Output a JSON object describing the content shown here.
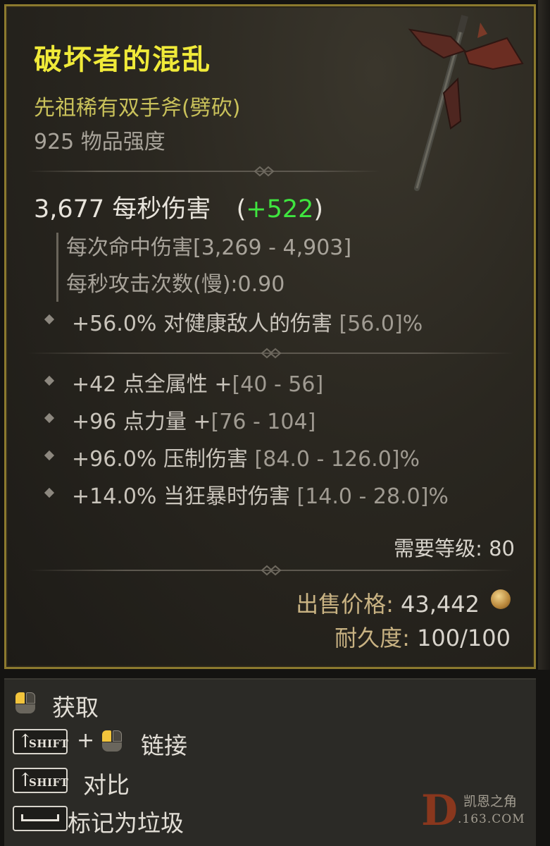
{
  "item": {
    "name": "破坏者的混乱",
    "type_line": "先祖稀有双手斧(劈砍)",
    "item_power": "925 物品强度",
    "dps_value": "3,677 每秒伤害",
    "dps_open": "(",
    "dps_bonus": "+522",
    "dps_close": ")",
    "damage_per_hit": "每次命中伤害[3,269 - 4,903]",
    "attacks_per_second": "每秒攻击次数(慢):0.90",
    "implicit": {
      "text": "+56.0% 对健康敌人的伤害 ",
      "range": "[56.0]%"
    },
    "affixes": [
      {
        "text": "+42 点全属性 +",
        "range": "[40 - 56]"
      },
      {
        "text": "+96 点力量 +",
        "range": "[76 - 104]"
      },
      {
        "text": "+96.0% 压制伤害 ",
        "range": "[84.0 - 126.0]%"
      },
      {
        "text": "+14.0% 当狂暴时伤害 ",
        "range": "[14.0 - 28.0]%"
      }
    ],
    "required_level": "需要等级: 80",
    "sell_label": "出售价格:",
    "sell_value": " 43,442",
    "durability_label": "耐久度:",
    "durability_value": " 100/100"
  },
  "actions": {
    "take": "获取",
    "link": "链接",
    "compare": "对比",
    "junk": "标记为垃圾",
    "shift_key": "SHIFT",
    "plus": "+"
  },
  "watermark": {
    "letter": "D",
    "site_name": "凯恩之角",
    "url": ".163.COM"
  },
  "colors": {
    "title": "#f0ea39",
    "type_line": "#c9c15a",
    "dps_bonus": "#3fe53f",
    "border": "#8c7a2e"
  }
}
